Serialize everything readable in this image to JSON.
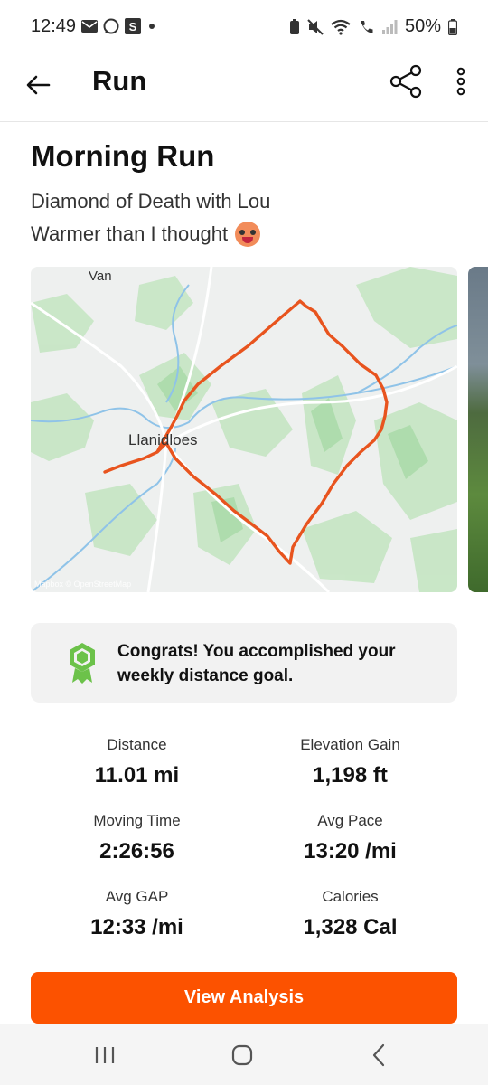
{
  "status_bar": {
    "time": "12:49",
    "battery": "50%",
    "left_icons": [
      "mail-icon",
      "whatsapp-icon",
      "s-app-icon",
      "dot-icon"
    ],
    "right_icons": [
      "battery-saver-icon",
      "mute-icon",
      "wifi-icon",
      "call-icon",
      "signal-icon",
      "battery-icon"
    ]
  },
  "header": {
    "title": "Run"
  },
  "activity": {
    "title": "Morning Run",
    "description_line1": "Diamond of Death with Lou",
    "description_line2": "Warmer than I thought",
    "emoji": "hot-face-emoji"
  },
  "map": {
    "label_van": "Van",
    "label_town": "Llanidloes",
    "credit": "Mapbox © OpenStreetMap",
    "route_color": "#e8541e"
  },
  "congrats": {
    "text": "Congrats! You accomplished your weekly distance goal.",
    "badge_color": "#6cc24a"
  },
  "stats": [
    {
      "label": "Distance",
      "value": "11.01 mi"
    },
    {
      "label": "Elevation Gain",
      "value": "1,198 ft"
    },
    {
      "label": "Moving Time",
      "value": "2:26:56"
    },
    {
      "label": "Avg Pace",
      "value": "13:20 /mi"
    },
    {
      "label": "Avg GAP",
      "value": "12:33 /mi"
    },
    {
      "label": "Calories",
      "value": "1,328 Cal"
    }
  ],
  "cta": {
    "label": "View Analysis",
    "color": "#fc5200"
  },
  "navbar": {
    "icons": [
      "recent-apps-icon",
      "home-icon",
      "back-nav-icon"
    ]
  }
}
